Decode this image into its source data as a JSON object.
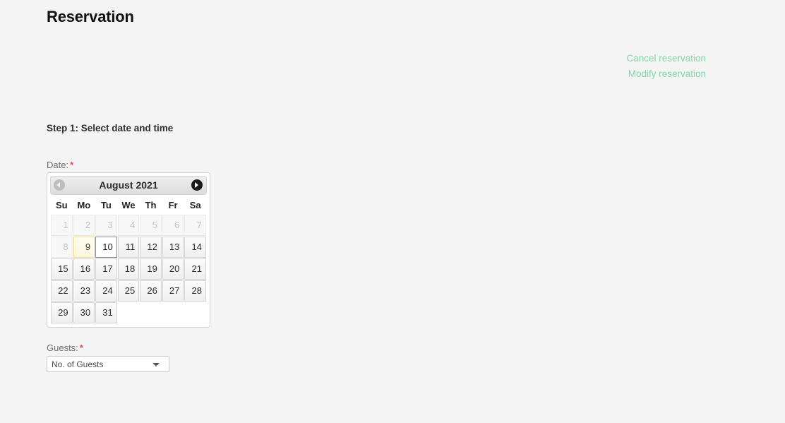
{
  "page": {
    "title": "Reservation",
    "background_color": "#f4f4f4"
  },
  "actions": {
    "link_color": "#82d7a7",
    "items": [
      {
        "label": "Cancel reservation",
        "name": "cancel-reservation-link"
      },
      {
        "label": "Modify reservation",
        "name": "modify-reservation-link"
      }
    ]
  },
  "form": {
    "step_heading": "Step 1: Select date and time",
    "date": {
      "label": "Date:",
      "required_marker": "*"
    },
    "guests": {
      "label": "Guests:",
      "required_marker": "*",
      "selected_value": "No. of Guests"
    }
  },
  "datepicker": {
    "month_year": "August 2021",
    "prev_label": "Prev",
    "next_label": "Next",
    "prev_disabled": true,
    "weekdays": [
      "Su",
      "Mo",
      "Tu",
      "We",
      "Th",
      "Fr",
      "Sa"
    ],
    "weeks": [
      [
        {
          "day": "1",
          "state": "disabled"
        },
        {
          "day": "2",
          "state": "disabled"
        },
        {
          "day": "3",
          "state": "disabled"
        },
        {
          "day": "4",
          "state": "disabled"
        },
        {
          "day": "5",
          "state": "disabled"
        },
        {
          "day": "6",
          "state": "disabled"
        },
        {
          "day": "7",
          "state": "disabled"
        }
      ],
      [
        {
          "day": "8",
          "state": "disabled"
        },
        {
          "day": "9",
          "state": "hover"
        },
        {
          "day": "10",
          "state": "today"
        },
        {
          "day": "11",
          "state": "active"
        },
        {
          "day": "12",
          "state": "active"
        },
        {
          "day": "13",
          "state": "active"
        },
        {
          "day": "14",
          "state": "active"
        }
      ],
      [
        {
          "day": "15",
          "state": "active"
        },
        {
          "day": "16",
          "state": "active"
        },
        {
          "day": "17",
          "state": "active"
        },
        {
          "day": "18",
          "state": "active"
        },
        {
          "day": "19",
          "state": "active"
        },
        {
          "day": "20",
          "state": "active"
        },
        {
          "day": "21",
          "state": "active"
        }
      ],
      [
        {
          "day": "22",
          "state": "active"
        },
        {
          "day": "23",
          "state": "active"
        },
        {
          "day": "24",
          "state": "active"
        },
        {
          "day": "25",
          "state": "active"
        },
        {
          "day": "26",
          "state": "active"
        },
        {
          "day": "27",
          "state": "active"
        },
        {
          "day": "28",
          "state": "active"
        }
      ],
      [
        {
          "day": "29",
          "state": "active"
        },
        {
          "day": "30",
          "state": "active"
        },
        {
          "day": "31",
          "state": "active"
        },
        {
          "day": "",
          "state": "empty"
        },
        {
          "day": "",
          "state": "empty"
        },
        {
          "day": "",
          "state": "empty"
        },
        {
          "day": "",
          "state": "empty"
        }
      ]
    ]
  }
}
